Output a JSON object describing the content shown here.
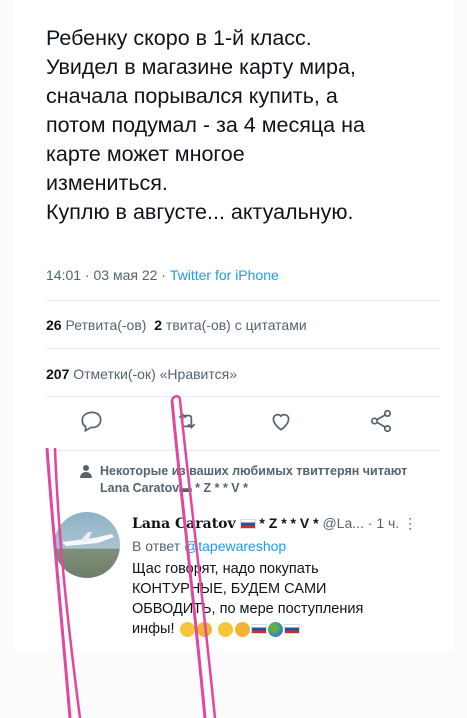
{
  "tweet": {
    "text": "Ребенку скоро в 1-й класс.\nУвидел в магазине карту мира,\nсначала порывался купить, а\nпотом подумал - за 4 месяца на\nкарте может многое\nизмениться.\nКуплю в августе... актуальную.",
    "timestamp": "14:01 · 03 мая 22 · ",
    "source": "Twitter for iPhone"
  },
  "stats": {
    "retweets_count": "26",
    "retweets_label": "Ретвита(-ов)",
    "quotes_count": "2",
    "quotes_label": "твита(-ов) с цитатами",
    "likes_count": "207",
    "likes_label": "Отметки(-ок) «Нравится»"
  },
  "actions": [
    "reply-icon",
    "retweet-icon",
    "heart-icon",
    "share-icon"
  ],
  "social_context": "Некоторые из ваших любимых твиттерян читают Lana Caratov▬ * Z * * V *",
  "reply": {
    "name": "Lana Caratov",
    "badges": "* Z * * V *",
    "handle": "@La...",
    "time": "· 1 ч.",
    "reply_to_prefix": "В ответ ",
    "reply_to_handle": "@tapewareshop",
    "body": "Щас говорят, надо покупать\nКОНТУРНЫЕ, БУДЕМ САМИ\nОБВОДИТЬ,  по мере поступления\nинфы!"
  },
  "colors": {
    "accent": "#1d9bf0",
    "muted": "#536471",
    "pen": "#e0479e"
  }
}
